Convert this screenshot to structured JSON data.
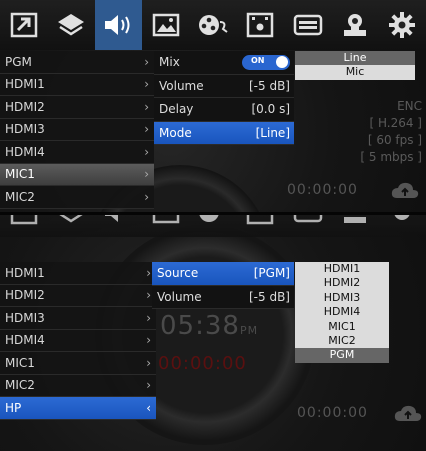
{
  "toolbar": {
    "icons": [
      "pip-layout-icon",
      "layers-icon",
      "audio-speaker-icon",
      "image-icon",
      "settings-dial-icon",
      "recording-icon",
      "hdmi-port-icon",
      "camera-icon",
      "gear-icon"
    ],
    "active_index": 2
  },
  "top": {
    "sources": [
      {
        "label": "PGM"
      },
      {
        "label": "HDMI1"
      },
      {
        "label": "HDMI2"
      },
      {
        "label": "HDMI3"
      },
      {
        "label": "HDMI4"
      },
      {
        "label": "MIC1",
        "selected": true
      },
      {
        "label": "MIC2"
      }
    ],
    "submenu": [
      {
        "label": "Mix",
        "type": "toggle",
        "value": "ON"
      },
      {
        "label": "Volume",
        "value": "[-5 dB]"
      },
      {
        "label": "Delay",
        "value": "[0.0 s]"
      },
      {
        "label": "Mode",
        "value": "[Line]",
        "active": true
      }
    ],
    "mode_options": [
      "Line",
      "Mic"
    ],
    "mode_selected": "Line",
    "encoder": {
      "title": "ENC",
      "codec": "[ H.264 ]",
      "fps": "[ 60 fps ]",
      "bitrate": "[ 5 mbps ]"
    },
    "rec_time": "00:00:00"
  },
  "bottom": {
    "sources": [
      {
        "label": "HDMI1"
      },
      {
        "label": "HDMI2"
      },
      {
        "label": "HDMI3"
      },
      {
        "label": "HDMI4"
      },
      {
        "label": "MIC1"
      },
      {
        "label": "MIC2"
      },
      {
        "label": "HP",
        "selected": true
      }
    ],
    "submenu": [
      {
        "label": "Source",
        "value": "[PGM]",
        "active": true
      },
      {
        "label": "Volume",
        "value": "[-5 dB]"
      }
    ],
    "source_options": [
      "HDMI1",
      "HDMI2",
      "HDMI3",
      "HDMI4",
      "MIC1",
      "MIC2",
      "PGM"
    ],
    "source_selected": "PGM",
    "clock": "05:38",
    "clock_suffix": "PM",
    "countdown": "00:00:00",
    "rec_time": "00:00:00"
  },
  "colors": {
    "accent": "#2c6ad4",
    "selected_row": "#4a4a4a",
    "list_bg": "#dcdcdc"
  }
}
